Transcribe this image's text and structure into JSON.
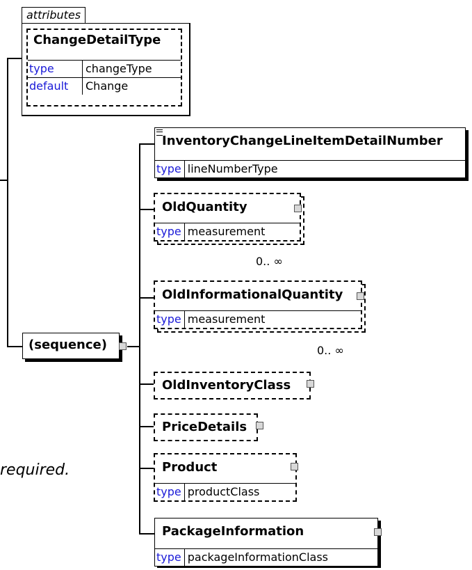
{
  "attributes": {
    "tab_label": "attributes",
    "name": "ChangeDetailType",
    "rows": [
      {
        "key": "type",
        "value": "changeType"
      },
      {
        "key": "default",
        "value": "Change"
      }
    ]
  },
  "sequence": {
    "label": "(sequence)"
  },
  "elements": [
    {
      "name": "InventoryChangeLineItemDetailNumber",
      "type_key": "type",
      "type_value": "lineNumberType"
    },
    {
      "name": "OldQuantity",
      "type_key": "type",
      "type_value": "measurement",
      "cardinality": "0.. ∞"
    },
    {
      "name": "OldInformationalQuantity",
      "type_key": "type",
      "type_value": "measurement",
      "cardinality": "0.. ∞"
    },
    {
      "name": "OldInventoryClass"
    },
    {
      "name": "PriceDetails"
    },
    {
      "name": "Product",
      "type_key": "type",
      "type_value": "productClass"
    },
    {
      "name": "PackageInformation",
      "type_key": "type",
      "type_value": "packageInformationClass"
    }
  ],
  "note": {
    "text": "required."
  }
}
